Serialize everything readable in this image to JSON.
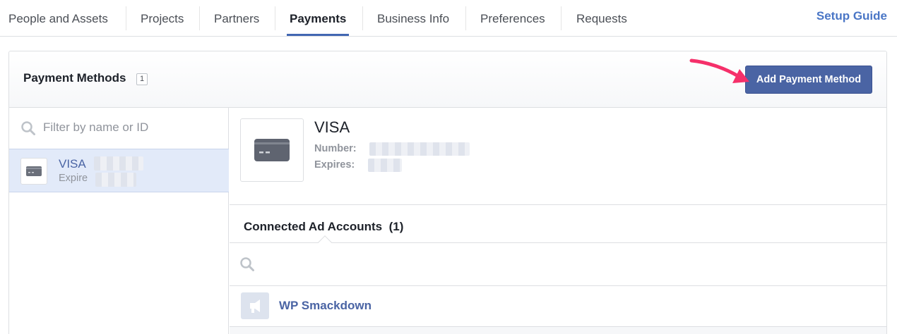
{
  "nav": {
    "tabs": [
      {
        "label": "People and Assets"
      },
      {
        "label": "Projects"
      },
      {
        "label": "Partners"
      },
      {
        "label": "Payments"
      },
      {
        "label": "Business Info"
      },
      {
        "label": "Preferences"
      },
      {
        "label": "Requests"
      }
    ],
    "active_tab": "Payments",
    "setup_guide": "Setup Guide"
  },
  "payment_methods": {
    "title": "Payment Methods",
    "count": "1",
    "add_button": "Add Payment Method",
    "filter_placeholder": "Filter by name or ID",
    "items": [
      {
        "title": "VISA",
        "subtitle": "Expire"
      }
    ]
  },
  "detail": {
    "title": "VISA",
    "number_label": "Number:",
    "expires_label": "Expires:",
    "connected_title": "Connected Ad Accounts",
    "connected_count": "(1)",
    "accounts": [
      {
        "name": "WP Smackdown"
      }
    ]
  },
  "colors": {
    "accent": "#4267b2",
    "button": "#4a64a4",
    "annotation_arrow": "#f5306a"
  },
  "icons": [
    "search-icon",
    "credit-card-icon",
    "megaphone-icon"
  ]
}
